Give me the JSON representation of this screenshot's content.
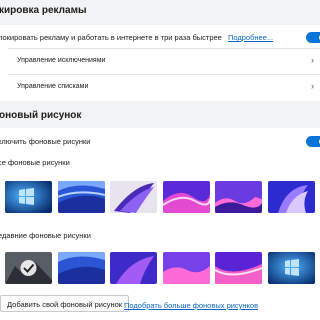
{
  "ads": {
    "heading": "кировка рекламы",
    "block_text": "локировать рекламу и работать в интернете в три раза быстрее",
    "more_link": "Подробнее...",
    "block_toggle_on": true,
    "exceptions_label": "Управление исключениями",
    "lists_label": "Управление списками"
  },
  "wallpaper": {
    "heading": "оновый рисунок",
    "enable_text": "ключить фоновые рисунки",
    "enable_toggle_on": true,
    "all_heading": "се фоновые рисунки",
    "recent_heading": "едавние фоновые рисунки",
    "add_button": "Добавить свой фоновый рисунок",
    "more_link": "Подобрать больше фоновых рисунков"
  },
  "colors": {
    "accent": "#0a74d8",
    "link": "#0a66c2"
  }
}
